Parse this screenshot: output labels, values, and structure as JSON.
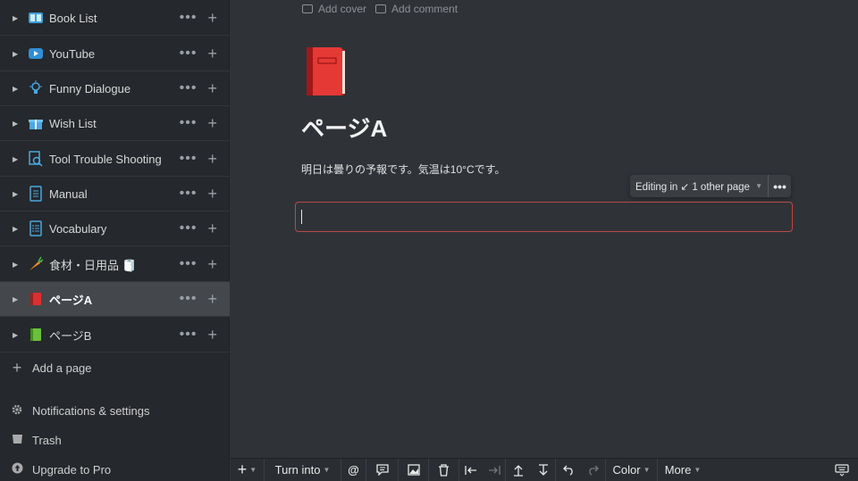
{
  "sidebar": {
    "items": [
      {
        "label": "Book List",
        "icon": "book-icon"
      },
      {
        "label": "YouTube",
        "icon": "youtube-icon"
      },
      {
        "label": "Funny Dialogue",
        "icon": "bulb-icon"
      },
      {
        "label": "Wish List",
        "icon": "gift-icon"
      },
      {
        "label": "Tool Trouble Shooting",
        "icon": "search-doc-icon"
      },
      {
        "label": "Manual",
        "icon": "document-icon"
      },
      {
        "label": "Vocabulary",
        "icon": "list-icon"
      },
      {
        "label": "食材・日用品 🧻",
        "icon": "carrot-icon"
      },
      {
        "label": "ページA",
        "icon": "red-book-icon"
      },
      {
        "label": "ページB",
        "icon": "green-book-icon"
      }
    ],
    "dots": "•••",
    "plus": "+",
    "add_page": "Add a page",
    "notifications": "Notifications & settings",
    "trash": "Trash",
    "upgrade": "Upgrade to Pro"
  },
  "page": {
    "add_cover": "Add cover",
    "add_comment": "Add comment",
    "title": "ページA",
    "body_text": "明日は曇りの予報です。気温は10°Cです。",
    "editing_badge": "Editing in ↙ 1 other page",
    "editing_more": "•••"
  },
  "toolbar": {
    "add": "+",
    "turn_into": "Turn into",
    "mention": "@",
    "color": "Color",
    "more": "More"
  },
  "colors": {
    "sidebar_bg": "#25282c",
    "main_bg": "#2f3338",
    "active_item_bg": "#44484d",
    "focus_border": "#b84a45"
  }
}
